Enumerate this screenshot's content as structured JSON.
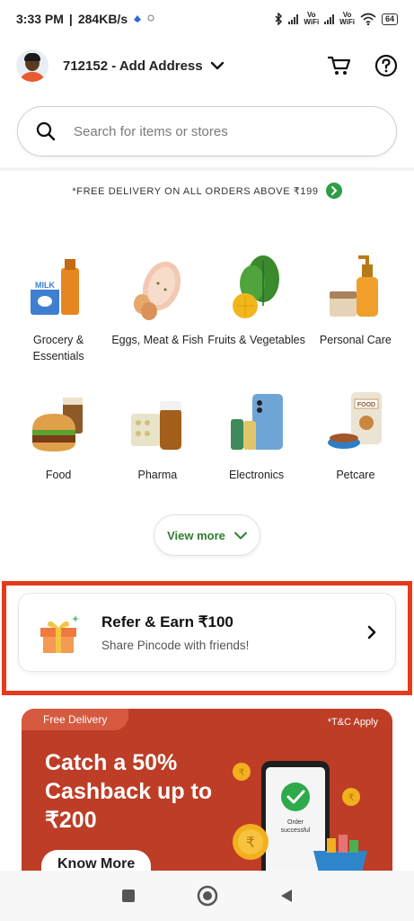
{
  "status_bar": {
    "time": "3:33 PM",
    "speed": "284KB/s",
    "volte1": "Vo\nWiFi",
    "volte2": "Vo\nWiFi",
    "battery": "64"
  },
  "header": {
    "address": "712152 - Add Address",
    "icons": [
      "avatar",
      "chevron-down-icon",
      "cart-icon",
      "help-icon"
    ]
  },
  "search": {
    "placeholder": "Search for items or stores"
  },
  "promo": {
    "text": "*FREE DELIVERY ON ALL ORDERS ABOVE ₹199"
  },
  "categories": [
    {
      "label": "Grocery & Essentials"
    },
    {
      "label": "Eggs, Meat & Fish"
    },
    {
      "label": "Fruits & Vegetables"
    },
    {
      "label": "Personal Care"
    },
    {
      "label": "Food"
    },
    {
      "label": "Pharma"
    },
    {
      "label": "Electronics"
    },
    {
      "label": "Petcare"
    }
  ],
  "view_more": "View more",
  "refer": {
    "title": "Refer & Earn ₹100",
    "subtitle": "Share Pincode with friends!"
  },
  "banner": {
    "tag": "Free Delivery",
    "tc": "*T&C Apply",
    "title": "Catch a 50% Cashback up to ₹200",
    "button": "Know More",
    "order_text": "Order successful"
  },
  "colors": {
    "accent_green": "#2e9e44",
    "highlight_red": "#e63a1d",
    "banner_red": "#bd3d26"
  }
}
